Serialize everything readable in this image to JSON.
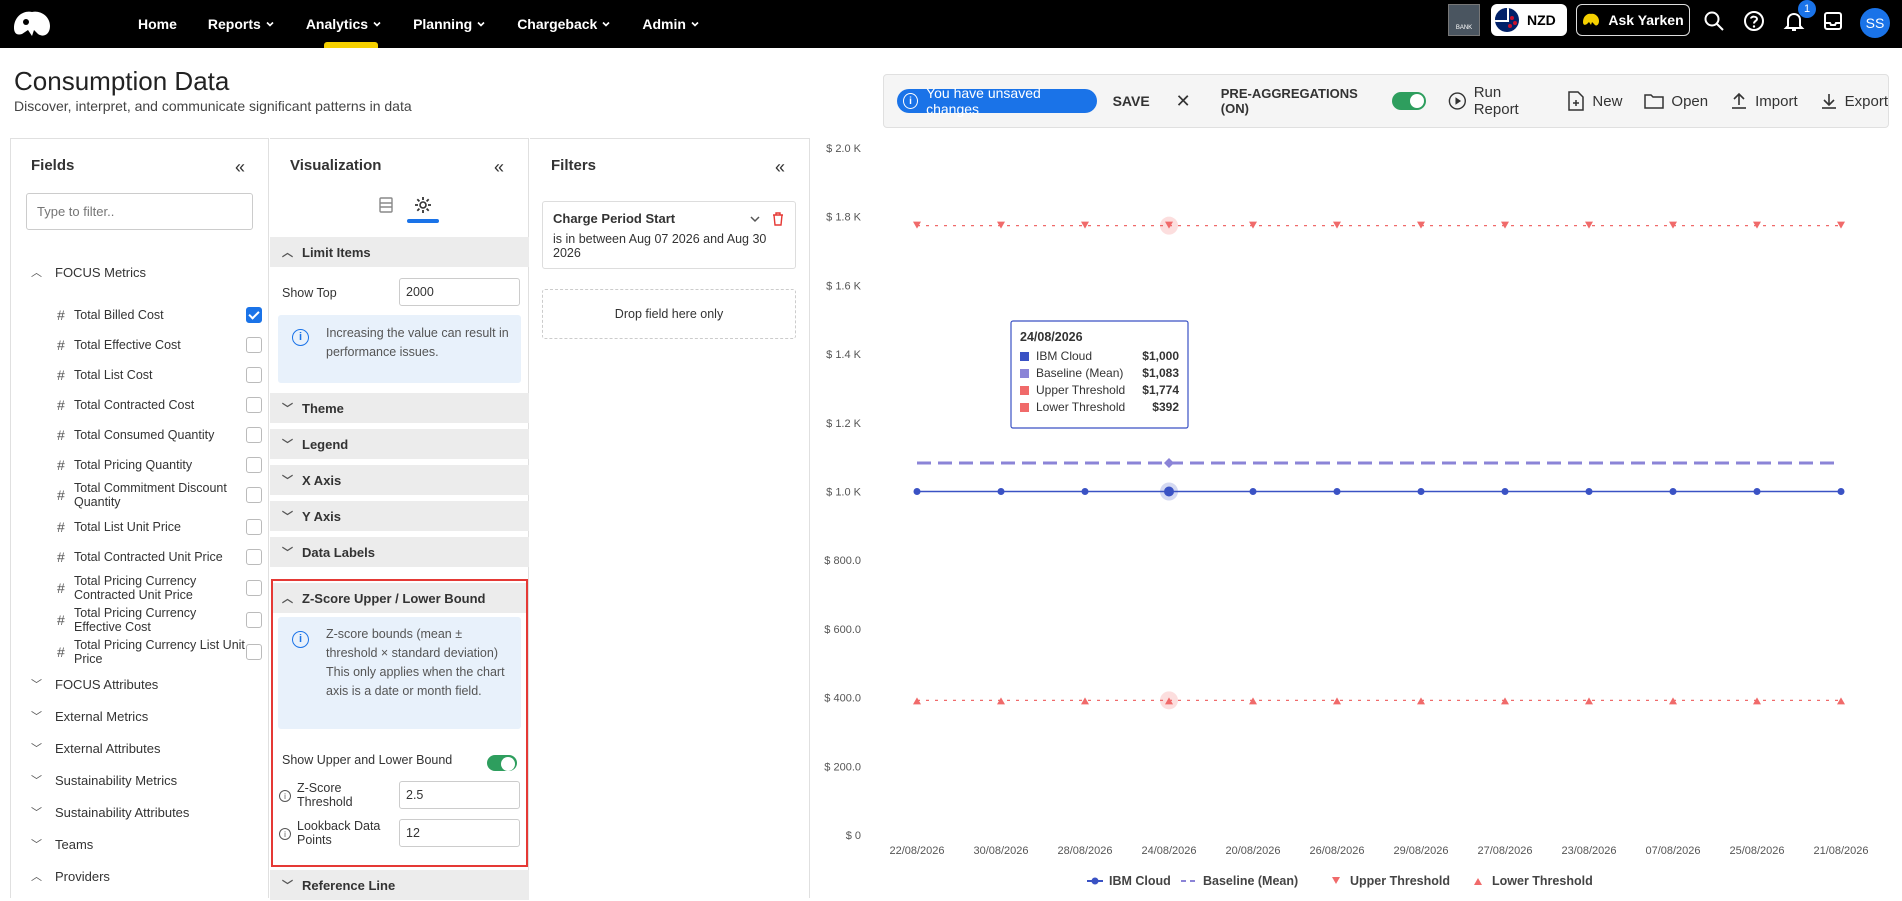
{
  "nav": {
    "items": [
      {
        "label": "Home",
        "dropdown": false
      },
      {
        "label": "Reports",
        "dropdown": true
      },
      {
        "label": "Analytics",
        "dropdown": true
      },
      {
        "label": "Planning",
        "dropdown": true
      },
      {
        "label": "Chargeback",
        "dropdown": true
      },
      {
        "label": "Admin",
        "dropdown": true
      }
    ],
    "active": "Analytics",
    "bank_label": "BANK",
    "currency": "NZD",
    "ask_label": "Ask Yarken",
    "notification_count": "1",
    "avatar_initials": "SS"
  },
  "page": {
    "title": "Consumption Data",
    "subtitle": "Discover, interpret, and communicate significant patterns in data"
  },
  "toolbar": {
    "unsaved_text": "You have unsaved changes",
    "save_label": "SAVE",
    "preagg_label": "PRE-AGGREGATIONS (ON)",
    "run_label": "Run Report",
    "new_label": "New",
    "open_label": "Open",
    "import_label": "Import",
    "export_label": "Export"
  },
  "fields_panel": {
    "title": "Fields",
    "filter_placeholder": "Type to filter..",
    "focus_metrics_label": "FOCUS Metrics",
    "metrics": [
      {
        "label": "Total Billed Cost",
        "checked": true
      },
      {
        "label": "Total Effective Cost",
        "checked": false
      },
      {
        "label": "Total List Cost",
        "checked": false
      },
      {
        "label": "Total Contracted Cost",
        "checked": false
      },
      {
        "label": "Total Consumed Quantity",
        "checked": false
      },
      {
        "label": "Total Pricing Quantity",
        "checked": false
      },
      {
        "label": "Total Commitment Discount Quantity",
        "checked": false
      },
      {
        "label": "Total List Unit Price",
        "checked": false
      },
      {
        "label": "Total Contracted Unit Price",
        "checked": false
      },
      {
        "label": "Total Pricing Currency Contracted Unit Price",
        "checked": false
      },
      {
        "label": "Total Pricing Currency Effective Cost",
        "checked": false
      },
      {
        "label": "Total Pricing Currency List Unit Price",
        "checked": false
      }
    ],
    "sections": [
      "FOCUS Attributes",
      "External Metrics",
      "External Attributes",
      "Sustainability Metrics",
      "Sustainability Attributes",
      "Teams",
      "Providers"
    ]
  },
  "viz_panel": {
    "title": "Visualization",
    "limit_items": "Limit Items",
    "show_top_label": "Show Top",
    "show_top_value": "2000",
    "limit_info": "Increasing the value can result in performance issues.",
    "theme": "Theme",
    "legend": "Legend",
    "x_axis": "X Axis",
    "y_axis": "Y Axis",
    "data_labels": "Data Labels",
    "zscore_title": "Z-Score Upper / Lower Bound",
    "zscore_info": "Z-score bounds (mean ± threshold × standard deviation) This only applies when the chart axis is a date or month field.",
    "show_bounds_label": "Show Upper and Lower Bound",
    "threshold_label": "Z-Score Threshold",
    "threshold_value": "2.5",
    "lookback_label": "Lookback Data Points",
    "lookback_value": "12",
    "reference_line": "Reference Line"
  },
  "filters_panel": {
    "title": "Filters",
    "filter_name": "Charge Period Start",
    "filter_desc": "is in between Aug 07 2026 and Aug 30 2026",
    "drop_text": "Drop field here only"
  },
  "chart_data": {
    "type": "line",
    "categories": [
      "22/08/2026",
      "30/08/2026",
      "28/08/2026",
      "24/08/2026",
      "20/08/2026",
      "26/08/2026",
      "29/08/2026",
      "27/08/2026",
      "23/08/2026",
      "07/08/2026",
      "25/08/2026",
      "21/08/2026"
    ],
    "y_ticks": [
      "$ 0",
      "$ 200.0",
      "$ 400.0",
      "$ 600.0",
      "$ 800.0",
      "$ 1.0 K",
      "$ 1.2 K",
      "$ 1.4 K",
      "$ 1.6 K",
      "$ 1.8 K",
      "$ 2.0 K"
    ],
    "ylim": [
      0,
      2000
    ],
    "grid": false,
    "legend_position": "bottom",
    "series": [
      {
        "name": "IBM Cloud",
        "values": [
          1000,
          1000,
          1000,
          1000,
          1000,
          1000,
          1000,
          1000,
          1000,
          1000,
          1000,
          1000
        ],
        "color": "#3a52c4",
        "style": "solid-circle"
      },
      {
        "name": "Baseline (Mean)",
        "values": [
          1083,
          1083,
          1083,
          1083,
          1083,
          1083,
          1083,
          1083,
          1083,
          1083,
          1083,
          1083
        ],
        "color": "#8b84d7",
        "style": "dashed-diamond"
      },
      {
        "name": "Upper Threshold",
        "values": [
          1774,
          1774,
          1774,
          1774,
          1774,
          1774,
          1774,
          1774,
          1774,
          1774,
          1774,
          1774
        ],
        "color": "#f06a6a",
        "style": "dotted-triangle-down"
      },
      {
        "name": "Lower Threshold",
        "values": [
          392,
          392,
          392,
          392,
          392,
          392,
          392,
          392,
          392,
          392,
          392,
          392
        ],
        "color": "#f06a6a",
        "style": "dotted-triangle-up"
      }
    ],
    "tooltip": {
      "date": "24/08/2026",
      "rows": [
        {
          "name": "IBM Cloud",
          "value": "$1,000",
          "color": "#3a52c4"
        },
        {
          "name": "Baseline (Mean)",
          "value": "$1,083",
          "color": "#8b84d7"
        },
        {
          "name": "Upper Threshold",
          "value": "$1,774",
          "color": "#f06a6a"
        },
        {
          "name": "Lower Threshold",
          "value": "$392",
          "color": "#f06a6a"
        }
      ]
    }
  }
}
